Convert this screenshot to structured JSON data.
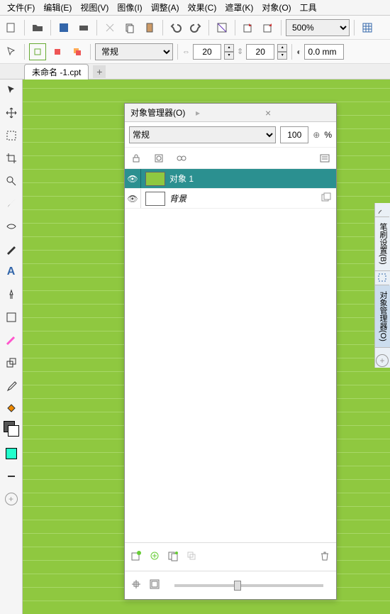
{
  "menu": {
    "file": "文件(F)",
    "edit": "编辑(E)",
    "view": "视图(V)",
    "image": "图像(I)",
    "adjust": "调整(A)",
    "effect": "效果(C)",
    "mask": "遮罩(K)",
    "object": "对象(O)",
    "tool": "工具"
  },
  "toolbar": {
    "zoom": "500%",
    "mode": "常规",
    "hspace": "20",
    "vspace": "20",
    "stroke": "0.0 mm"
  },
  "tab": {
    "name": "未命名 -1.cpt"
  },
  "panel": {
    "title": "对象管理器(O)",
    "blend": "常规",
    "opacity": "100",
    "percent": "%",
    "layers": [
      {
        "name": "对象 1",
        "sel": true,
        "color": "#8fc840"
      },
      {
        "name": "背景",
        "sel": false,
        "color": "#ffffff",
        "italic": true
      }
    ]
  },
  "righttabs": {
    "brush": "笔刷设置(B)",
    "objmgr": "对象管理器(O)"
  }
}
